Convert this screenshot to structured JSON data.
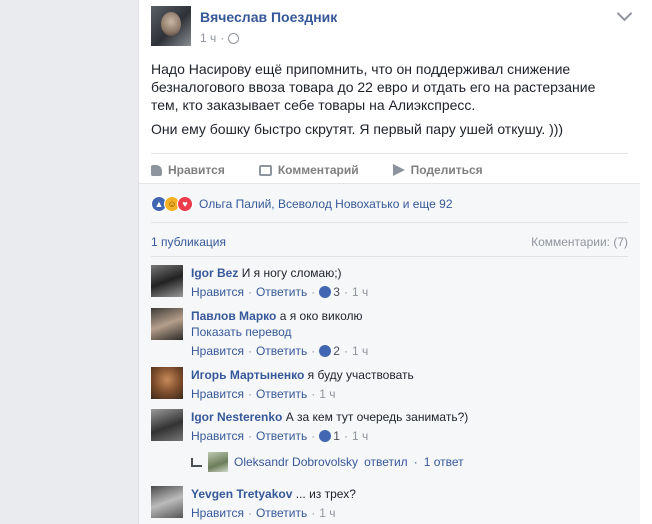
{
  "post": {
    "author": "Вячеслав Поездник",
    "time": "1 ч",
    "paragraphs": [
      "Надо Насирову ещё припомнить, что он поддерживал снижение безналогового ввоза товара до 22 евро и отдать его на растерзание тем, кто заказывает себе товары на Алиэкспресс.",
      "Они ему бошку быстро скрутят. Я первый пару ушей откушу. )))"
    ]
  },
  "actions": {
    "like": "Нравится",
    "comment": "Комментарий",
    "share": "Поделиться"
  },
  "reactions": {
    "names": "Ольга Палий, Всеволод Новохатько и еще 92",
    "icons": [
      "like-icon",
      "haha-icon",
      "love-icon"
    ]
  },
  "shares": "1 публикация",
  "comments_count": "Комментарии: (7)",
  "comments": [
    {
      "name": "Igor Bez",
      "text": "И я ногу сломаю;)",
      "like": "Нравится",
      "reply": "Ответить",
      "likes": "3",
      "time": "1 ч"
    },
    {
      "name": "Павлов Марко",
      "text": "а я око виколю",
      "translate": "Показать перевод",
      "like": "Нравится",
      "reply": "Ответить",
      "likes": "2",
      "time": "1 ч"
    },
    {
      "name": "Игорь Мартыненко",
      "text": "я буду участвовать",
      "like": "Нравится",
      "reply": "Ответить",
      "time": "1 ч"
    },
    {
      "name": "Igor Nesterenko",
      "text": "А за кем тут очередь занимать?)",
      "like": "Нравится",
      "reply": "Ответить",
      "likes": "1",
      "time": "1 ч"
    },
    {
      "name": "Yevgen Tretyakov",
      "text": "... из трех?",
      "like": "Нравится",
      "reply": "Ответить",
      "time": "1 ч"
    }
  ],
  "reply_summary": {
    "name": "Oleksandr Dobrovolsky",
    "action": "ответил",
    "count": "1 ответ"
  }
}
